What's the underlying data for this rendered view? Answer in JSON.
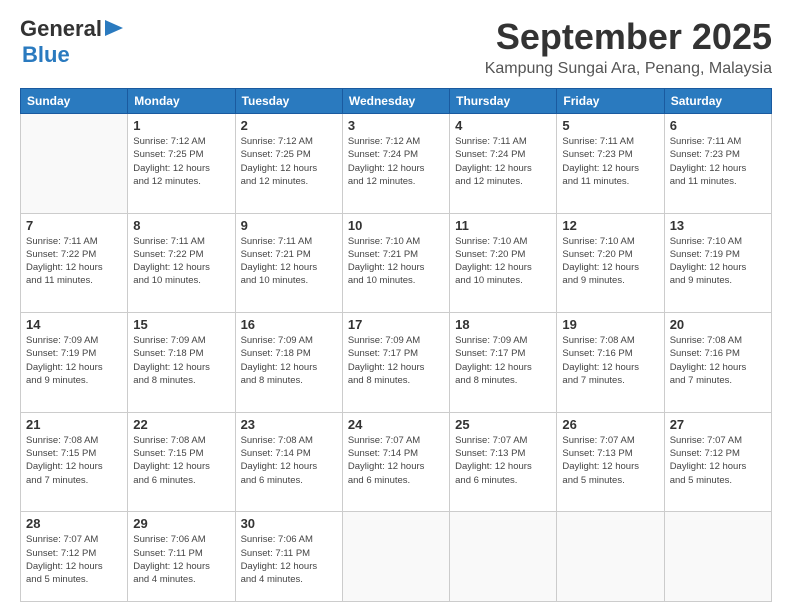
{
  "logo": {
    "general": "General",
    "blue": "Blue",
    "arrow": "▶"
  },
  "header": {
    "month_year": "September 2025",
    "location": "Kampung Sungai Ara, Penang, Malaysia"
  },
  "weekdays": [
    "Sunday",
    "Monday",
    "Tuesday",
    "Wednesday",
    "Thursday",
    "Friday",
    "Saturday"
  ],
  "weeks": [
    [
      {
        "day": "",
        "sunrise": "",
        "sunset": "",
        "daylight": ""
      },
      {
        "day": "1",
        "sunrise": "Sunrise: 7:12 AM",
        "sunset": "Sunset: 7:25 PM",
        "daylight": "Daylight: 12 hours and 12 minutes."
      },
      {
        "day": "2",
        "sunrise": "Sunrise: 7:12 AM",
        "sunset": "Sunset: 7:25 PM",
        "daylight": "Daylight: 12 hours and 12 minutes."
      },
      {
        "day": "3",
        "sunrise": "Sunrise: 7:12 AM",
        "sunset": "Sunset: 7:24 PM",
        "daylight": "Daylight: 12 hours and 12 minutes."
      },
      {
        "day": "4",
        "sunrise": "Sunrise: 7:11 AM",
        "sunset": "Sunset: 7:24 PM",
        "daylight": "Daylight: 12 hours and 12 minutes."
      },
      {
        "day": "5",
        "sunrise": "Sunrise: 7:11 AM",
        "sunset": "Sunset: 7:23 PM",
        "daylight": "Daylight: 12 hours and 11 minutes."
      },
      {
        "day": "6",
        "sunrise": "Sunrise: 7:11 AM",
        "sunset": "Sunset: 7:23 PM",
        "daylight": "Daylight: 12 hours and 11 minutes."
      }
    ],
    [
      {
        "day": "7",
        "sunrise": "Sunrise: 7:11 AM",
        "sunset": "Sunset: 7:22 PM",
        "daylight": "Daylight: 12 hours and 11 minutes."
      },
      {
        "day": "8",
        "sunrise": "Sunrise: 7:11 AM",
        "sunset": "Sunset: 7:22 PM",
        "daylight": "Daylight: 12 hours and 10 minutes."
      },
      {
        "day": "9",
        "sunrise": "Sunrise: 7:11 AM",
        "sunset": "Sunset: 7:21 PM",
        "daylight": "Daylight: 12 hours and 10 minutes."
      },
      {
        "day": "10",
        "sunrise": "Sunrise: 7:10 AM",
        "sunset": "Sunset: 7:21 PM",
        "daylight": "Daylight: 12 hours and 10 minutes."
      },
      {
        "day": "11",
        "sunrise": "Sunrise: 7:10 AM",
        "sunset": "Sunset: 7:20 PM",
        "daylight": "Daylight: 12 hours and 10 minutes."
      },
      {
        "day": "12",
        "sunrise": "Sunrise: 7:10 AM",
        "sunset": "Sunset: 7:20 PM",
        "daylight": "Daylight: 12 hours and 9 minutes."
      },
      {
        "day": "13",
        "sunrise": "Sunrise: 7:10 AM",
        "sunset": "Sunset: 7:19 PM",
        "daylight": "Daylight: 12 hours and 9 minutes."
      }
    ],
    [
      {
        "day": "14",
        "sunrise": "Sunrise: 7:09 AM",
        "sunset": "Sunset: 7:19 PM",
        "daylight": "Daylight: 12 hours and 9 minutes."
      },
      {
        "day": "15",
        "sunrise": "Sunrise: 7:09 AM",
        "sunset": "Sunset: 7:18 PM",
        "daylight": "Daylight: 12 hours and 8 minutes."
      },
      {
        "day": "16",
        "sunrise": "Sunrise: 7:09 AM",
        "sunset": "Sunset: 7:18 PM",
        "daylight": "Daylight: 12 hours and 8 minutes."
      },
      {
        "day": "17",
        "sunrise": "Sunrise: 7:09 AM",
        "sunset": "Sunset: 7:17 PM",
        "daylight": "Daylight: 12 hours and 8 minutes."
      },
      {
        "day": "18",
        "sunrise": "Sunrise: 7:09 AM",
        "sunset": "Sunset: 7:17 PM",
        "daylight": "Daylight: 12 hours and 8 minutes."
      },
      {
        "day": "19",
        "sunrise": "Sunrise: 7:08 AM",
        "sunset": "Sunset: 7:16 PM",
        "daylight": "Daylight: 12 hours and 7 minutes."
      },
      {
        "day": "20",
        "sunrise": "Sunrise: 7:08 AM",
        "sunset": "Sunset: 7:16 PM",
        "daylight": "Daylight: 12 hours and 7 minutes."
      }
    ],
    [
      {
        "day": "21",
        "sunrise": "Sunrise: 7:08 AM",
        "sunset": "Sunset: 7:15 PM",
        "daylight": "Daylight: 12 hours and 7 minutes."
      },
      {
        "day": "22",
        "sunrise": "Sunrise: 7:08 AM",
        "sunset": "Sunset: 7:15 PM",
        "daylight": "Daylight: 12 hours and 6 minutes."
      },
      {
        "day": "23",
        "sunrise": "Sunrise: 7:08 AM",
        "sunset": "Sunset: 7:14 PM",
        "daylight": "Daylight: 12 hours and 6 minutes."
      },
      {
        "day": "24",
        "sunrise": "Sunrise: 7:07 AM",
        "sunset": "Sunset: 7:14 PM",
        "daylight": "Daylight: 12 hours and 6 minutes."
      },
      {
        "day": "25",
        "sunrise": "Sunrise: 7:07 AM",
        "sunset": "Sunset: 7:13 PM",
        "daylight": "Daylight: 12 hours and 6 minutes."
      },
      {
        "day": "26",
        "sunrise": "Sunrise: 7:07 AM",
        "sunset": "Sunset: 7:13 PM",
        "daylight": "Daylight: 12 hours and 5 minutes."
      },
      {
        "day": "27",
        "sunrise": "Sunrise: 7:07 AM",
        "sunset": "Sunset: 7:12 PM",
        "daylight": "Daylight: 12 hours and 5 minutes."
      }
    ],
    [
      {
        "day": "28",
        "sunrise": "Sunrise: 7:07 AM",
        "sunset": "Sunset: 7:12 PM",
        "daylight": "Daylight: 12 hours and 5 minutes."
      },
      {
        "day": "29",
        "sunrise": "Sunrise: 7:06 AM",
        "sunset": "Sunset: 7:11 PM",
        "daylight": "Daylight: 12 hours and 4 minutes."
      },
      {
        "day": "30",
        "sunrise": "Sunrise: 7:06 AM",
        "sunset": "Sunset: 7:11 PM",
        "daylight": "Daylight: 12 hours and 4 minutes."
      },
      {
        "day": "",
        "sunrise": "",
        "sunset": "",
        "daylight": ""
      },
      {
        "day": "",
        "sunrise": "",
        "sunset": "",
        "daylight": ""
      },
      {
        "day": "",
        "sunrise": "",
        "sunset": "",
        "daylight": ""
      },
      {
        "day": "",
        "sunrise": "",
        "sunset": "",
        "daylight": ""
      }
    ]
  ]
}
